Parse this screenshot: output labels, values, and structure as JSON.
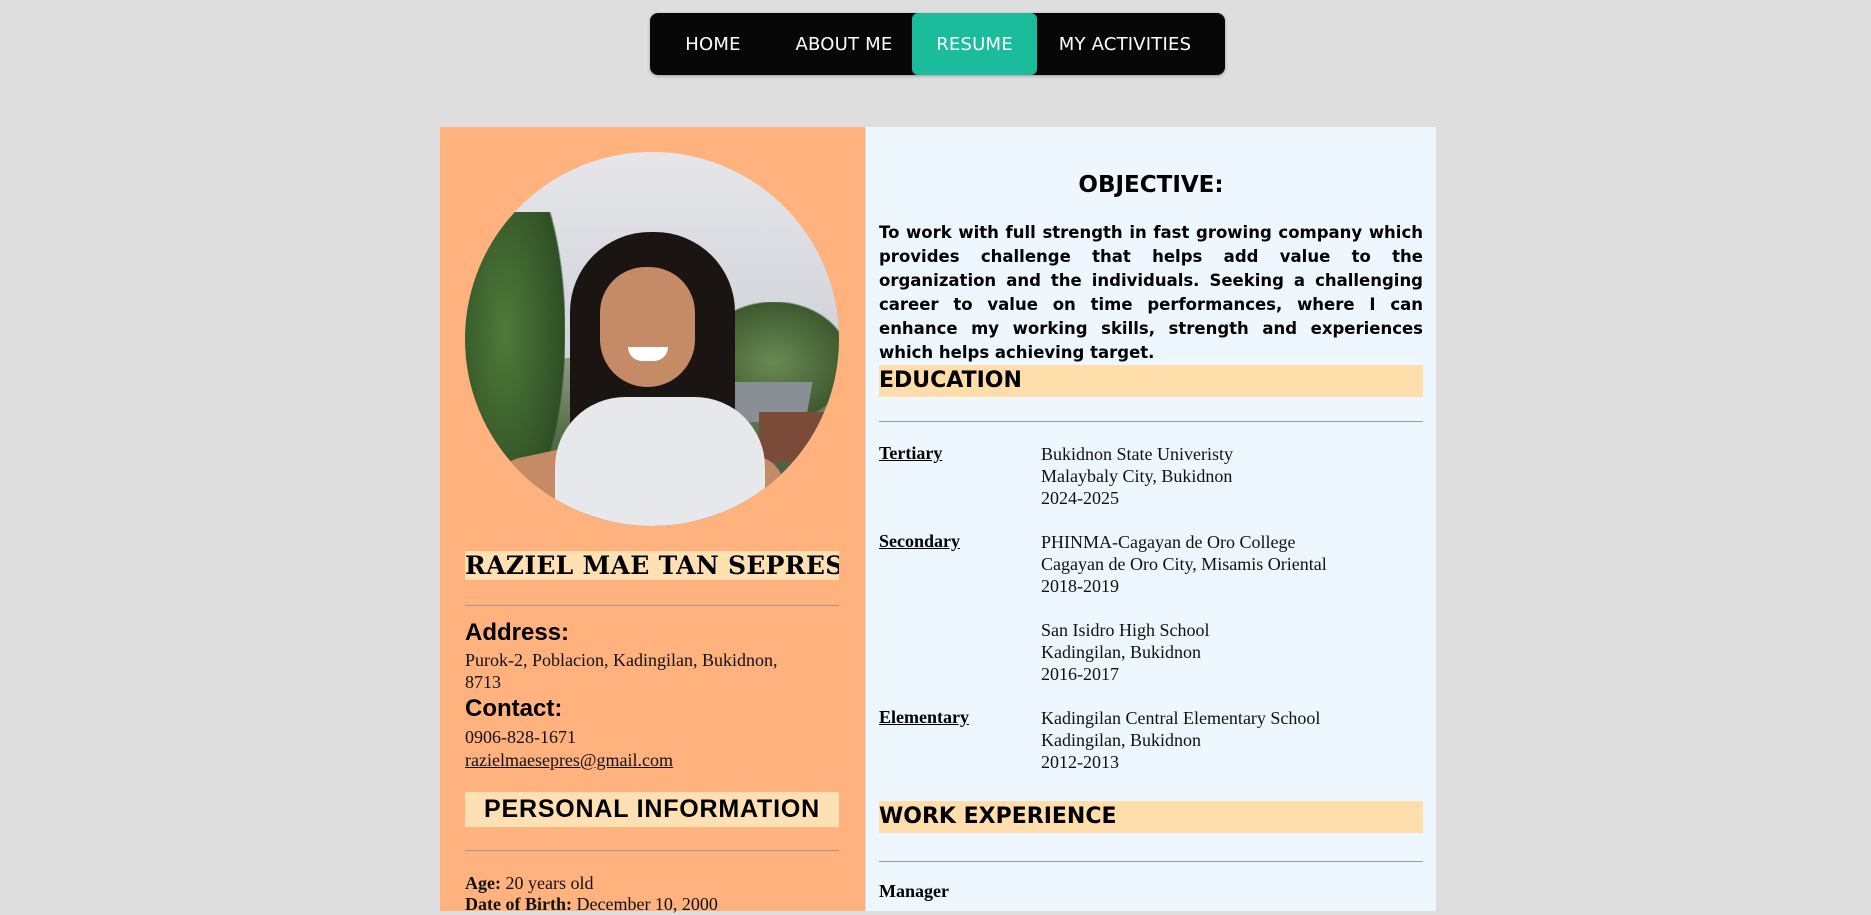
{
  "nav": {
    "items": [
      {
        "label": "HOME"
      },
      {
        "label": "ABOUT ME"
      },
      {
        "label": "RESUME",
        "active": true
      },
      {
        "label": "MY ACTIVITIES"
      }
    ],
    "active_color": "#1abc9c"
  },
  "profile": {
    "name": "RAZIEL MAE TAN SEPRES",
    "address_heading": "Address:",
    "address": "Purok-2, Poblacion, Kadingilan, Bukidnon, 8713",
    "contact_heading": "Contact:",
    "phone": "0906-828-1671",
    "email": "razielmaesepres@gmail.com"
  },
  "personal": {
    "heading": "PERSONAL INFORMATION",
    "age_label": "Age:",
    "age": "20 years old",
    "dob_label": "Date of Birth:",
    "dob": "December 10, 2000"
  },
  "objective": {
    "heading": "OBJECTIVE:",
    "text": "To work with full strength in fast growing company which provides challenge that helps add value to the organization and the individuals. Seeking a challenging career to value on time performances, where I can enhance my working skills, strength and experiences which helps achieving target."
  },
  "education": {
    "heading": "EDUCATION",
    "tertiary": {
      "label": "Tertiary",
      "school": "Bukidnon State Univeristy",
      "place": "Malaybaly City, Bukidnon",
      "years": "2024-2025"
    },
    "secondary": {
      "label": "Secondary",
      "school": "PHINMA-Cagayan de Oro College",
      "place": "Cagayan de Oro City, Misamis Oriental",
      "years": "2018-2019"
    },
    "secondary2": {
      "school": "San Isidro High School",
      "place": "Kadingilan, Bukidnon",
      "years": "2016-2017"
    },
    "elementary": {
      "label": "Elementary",
      "school": "Kadingilan Central Elementary School",
      "place": "Kadingilan, Bukidnon",
      "years": "2012-2013"
    }
  },
  "work": {
    "heading": "WORK EXPERIENCE",
    "first_title": "Manager"
  },
  "colors": {
    "background": "#dedede",
    "left_panel": "#ffb27d",
    "right_panel": "#eef6fe",
    "heading_band": "#ffdeab"
  }
}
